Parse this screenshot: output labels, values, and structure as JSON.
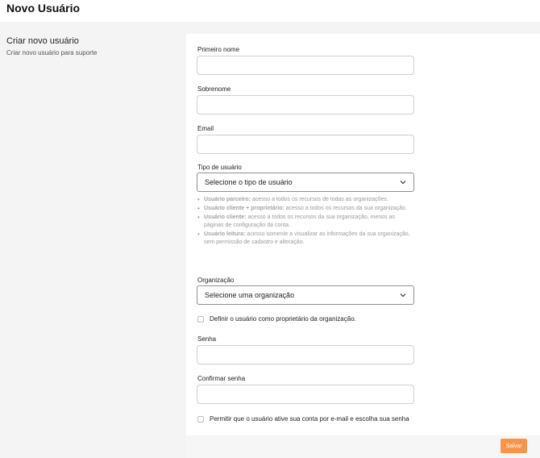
{
  "page": {
    "title": "Novo Usuário"
  },
  "side": {
    "title": "Criar novo usuário",
    "subtitle": "Criar novo usuário para suporte"
  },
  "form": {
    "first_name": {
      "label": "Primeiro nome",
      "value": ""
    },
    "last_name": {
      "label": "Sobrenome",
      "value": ""
    },
    "email": {
      "label": "Email",
      "value": ""
    },
    "user_type": {
      "label": "Tipo de usuário",
      "selected": "Selecione o tipo de usuário",
      "descriptions": [
        {
          "name": "Usuário parceiro:",
          "text": " acesso a todos os recursos de todas as organizações."
        },
        {
          "name": "Usuário cliente + proprietário:",
          "text": " acesso a todos os recursos da sua organização."
        },
        {
          "name": "Usuário cliente:",
          "text": " acesso a todos os recursos da sua organização, menos as páginas de configuração da conta."
        },
        {
          "name": "Usuário leitura:",
          "text": " acesso somente a visualizar as informações da sua organização, sem permissão de cadastro e alteração."
        }
      ]
    },
    "organization": {
      "label": "Organização",
      "selected": "Selecione uma organização"
    },
    "owner_checkbox": {
      "label": "Definir o usuário como proprietário da organização.",
      "checked": false
    },
    "password": {
      "label": "Senha",
      "value": ""
    },
    "confirm_password": {
      "label": "Confirmar senha",
      "value": ""
    },
    "activation_checkbox": {
      "label": "Permitir que o usuário ative sua conta por e-mail e escolha sua senha",
      "checked": false
    }
  },
  "actions": {
    "save_label": "Salvar"
  },
  "colors": {
    "accent": "#f7964a",
    "background": "#f4f4f4",
    "card": "#ffffff"
  }
}
